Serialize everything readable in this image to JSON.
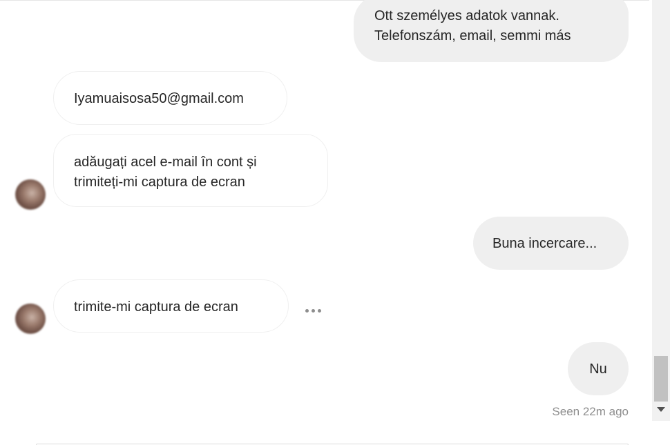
{
  "messages": [
    {
      "direction": "outgoing",
      "lines": [
        "Ott személyes adatok vannak.",
        "Telefonszám, email, semmi más"
      ]
    },
    {
      "direction": "incoming",
      "lines": [
        "Iyamuaisosa50@gmail.com"
      ]
    },
    {
      "direction": "incoming",
      "lines": [
        "adăugați acel e-mail în cont și",
        "trimiteți-mi captura de ecran"
      ]
    },
    {
      "direction": "outgoing",
      "lines": [
        "Buna incercare..."
      ]
    },
    {
      "direction": "incoming",
      "lines": [
        "trimite-mi captura de ecran"
      ]
    },
    {
      "direction": "outgoing",
      "lines": [
        "Nu"
      ]
    }
  ],
  "status": {
    "seen": "Seen 22m ago"
  },
  "icons": {
    "more": "more-options-icon",
    "avatar": "contact-avatar",
    "scroll_down": "scroll-down-arrow"
  },
  "colors": {
    "outgoing_bubble": "#efefef",
    "incoming_bubble_border": "#efefef",
    "text": "#262626",
    "secondary_text": "#8e8e8e"
  }
}
